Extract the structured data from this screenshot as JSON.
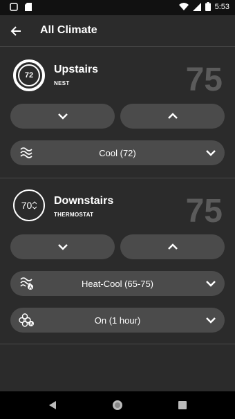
{
  "status_bar": {
    "time": "5:53"
  },
  "app_bar": {
    "title": "All Climate"
  },
  "devices": [
    {
      "icon_label": "72",
      "name": "Upstairs",
      "type": "NEST",
      "current_temp": "75",
      "mode": {
        "label": "Cool (72)",
        "icon": "wave-icon"
      }
    },
    {
      "icon_label": "70",
      "name": "Downstairs",
      "type": "THERMOSTAT",
      "current_temp": "75",
      "mode": {
        "label": "Heat-Cool (65-75)",
        "icon": "wave-auto-icon"
      },
      "fan": {
        "label": "On (1 hour)",
        "icon": "fan-auto-icon"
      }
    }
  ],
  "colors": {
    "background": "#2b2b2b",
    "pill": "#4b4b4b",
    "muted_temp": "#5b5b5b",
    "divider": "#4a4a4a"
  }
}
